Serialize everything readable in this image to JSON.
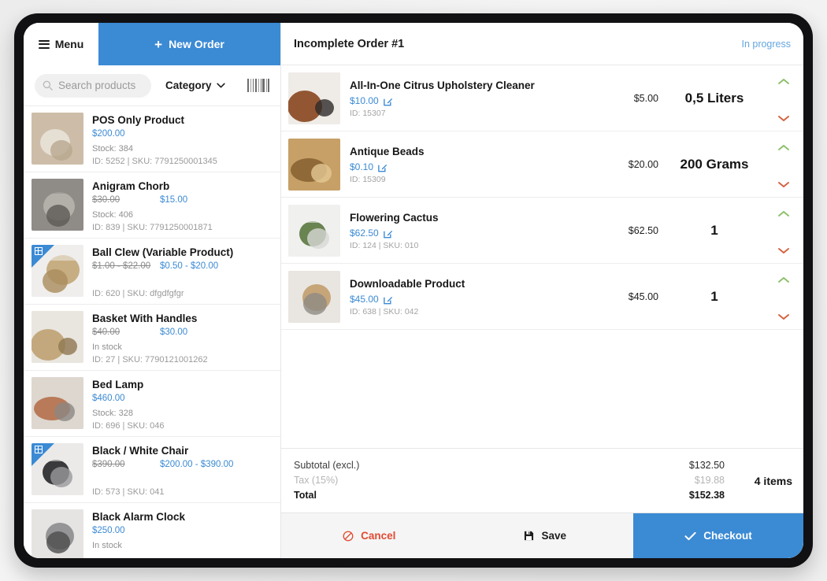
{
  "topbar": {
    "menu_label": "Menu",
    "menu_icon": "hamburger-icon",
    "new_order_label": "New Order",
    "new_order_icon": "plus-icon",
    "accent_color": "#3b8ad4"
  },
  "filter_bar": {
    "search_placeholder": "Search products",
    "search_value": "",
    "search_icon": "search-icon",
    "category_label": "Category",
    "category_icon": "chevron-down-icon",
    "barcode_icon": "barcode-icon"
  },
  "products": [
    {
      "name": "POS Only Product",
      "price_old": "",
      "price_new": "$200.00",
      "stock": "Stock: 384",
      "ids": "ID: 5252 | SKU: 7791250001345",
      "variable": false,
      "thumb_colors": [
        "#cdbda8",
        "#e8e2d8",
        "#b8a88f"
      ]
    },
    {
      "name": "Anigram Chorb",
      "price_old": "$30.00",
      "price_new": "$15.00",
      "stock": "Stock: 406",
      "ids": "ID: 839 | SKU: 7791250001871",
      "variable": false,
      "thumb_colors": [
        "#8f8c88",
        "#b6b2ab",
        "#5d5a56"
      ]
    },
    {
      "name": "Ball Clew (Variable Product)",
      "price_old": "$1.00 - $22.00",
      "price_new": "$0.50 - $20.00",
      "stock": "",
      "ids": "ID: 620 | SKU: dfgdfgfgr",
      "variable": true,
      "thumb_colors": [
        "#efeeec",
        "#c3a878",
        "#a98c5c"
      ]
    },
    {
      "name": "Basket With Handles",
      "price_old": "$40.00",
      "price_new": "$30.00",
      "stock": "In stock",
      "ids": "ID: 27 | SKU: 7790121001262",
      "variable": false,
      "thumb_colors": [
        "#e9e6e0",
        "#c0a374",
        "#8e7750"
      ]
    },
    {
      "name": "Bed Lamp",
      "price_old": "",
      "price_new": "$460.00",
      "stock": "Stock: 328",
      "ids": "ID: 696 | SKU: 046",
      "variable": false,
      "thumb_colors": [
        "#ddd7cf",
        "#b5724f",
        "#8c8782"
      ]
    },
    {
      "name": "Black / White Chair",
      "price_old": "$390.00",
      "price_new": "$200.00 - $390.00",
      "stock": "",
      "ids": "ID: 573 | SKU: 041",
      "variable": true,
      "thumb_colors": [
        "#eceae8",
        "#2a2a2c",
        "#9a9a9c"
      ]
    },
    {
      "name": "Black Alarm Clock",
      "price_old": "",
      "price_new": "$250.00",
      "stock": "In stock",
      "ids": "",
      "variable": false,
      "thumb_colors": [
        "#e6e4e2",
        "#8e8e90",
        "#4c4c4e"
      ]
    }
  ],
  "order": {
    "title": "Incomplete Order #1",
    "status": "In progress",
    "items": [
      {
        "name": "All-In-One Citrus Upholstery Cleaner",
        "unit_price": "$10.00",
        "edit_icon": "edit-pencil-icon",
        "ids": "ID: 15307",
        "line_total": "$5.00",
        "quantity": "0,5 Liters",
        "increase_icon": "chevron-up-icon",
        "decrease_icon": "chevron-down-icon",
        "thumb_colors": [
          "#efece8",
          "#8a4a22",
          "#2e2b29"
        ]
      },
      {
        "name": "Antique Beads",
        "unit_price": "$0.10",
        "edit_icon": "edit-pencil-icon",
        "ids": "ID: 15309",
        "line_total": "$20.00",
        "quantity": "200 Grams",
        "increase_icon": "chevron-up-icon",
        "decrease_icon": "chevron-down-icon",
        "thumb_colors": [
          "#c6a067",
          "#8a6433",
          "#e3c893"
        ]
      },
      {
        "name": "Flowering Cactus",
        "unit_price": "$62.50",
        "edit_icon": "edit-pencil-icon",
        "ids": "ID: 124 | SKU: 010",
        "line_total": "$62.50",
        "quantity": "1",
        "increase_icon": "chevron-up-icon",
        "decrease_icon": "chevron-down-icon",
        "thumb_colors": [
          "#f0f0ef",
          "#5d7a43",
          "#d8d8d6"
        ]
      },
      {
        "name": "Downloadable Product",
        "unit_price": "$45.00",
        "edit_icon": "edit-pencil-icon",
        "ids": "ID: 638 | SKU: 042",
        "line_total": "$45.00",
        "quantity": "1",
        "increase_icon": "chevron-up-icon",
        "decrease_icon": "chevron-down-icon",
        "thumb_colors": [
          "#e9e6e1",
          "#c2a070",
          "#8f8b85"
        ]
      }
    ],
    "totals": {
      "subtotal_label": "Subtotal (excl.)",
      "subtotal_value": "$132.50",
      "tax_label": "Tax (15%)",
      "tax_value": "$19.88",
      "total_label": "Total",
      "total_value": "$152.38",
      "items_count": "4 items"
    },
    "actions": {
      "cancel_label": "Cancel",
      "cancel_icon": "ban-circle-icon",
      "save_label": "Save",
      "save_icon": "floppy-disk-icon",
      "checkout_label": "Checkout",
      "checkout_icon": "check-icon"
    }
  }
}
